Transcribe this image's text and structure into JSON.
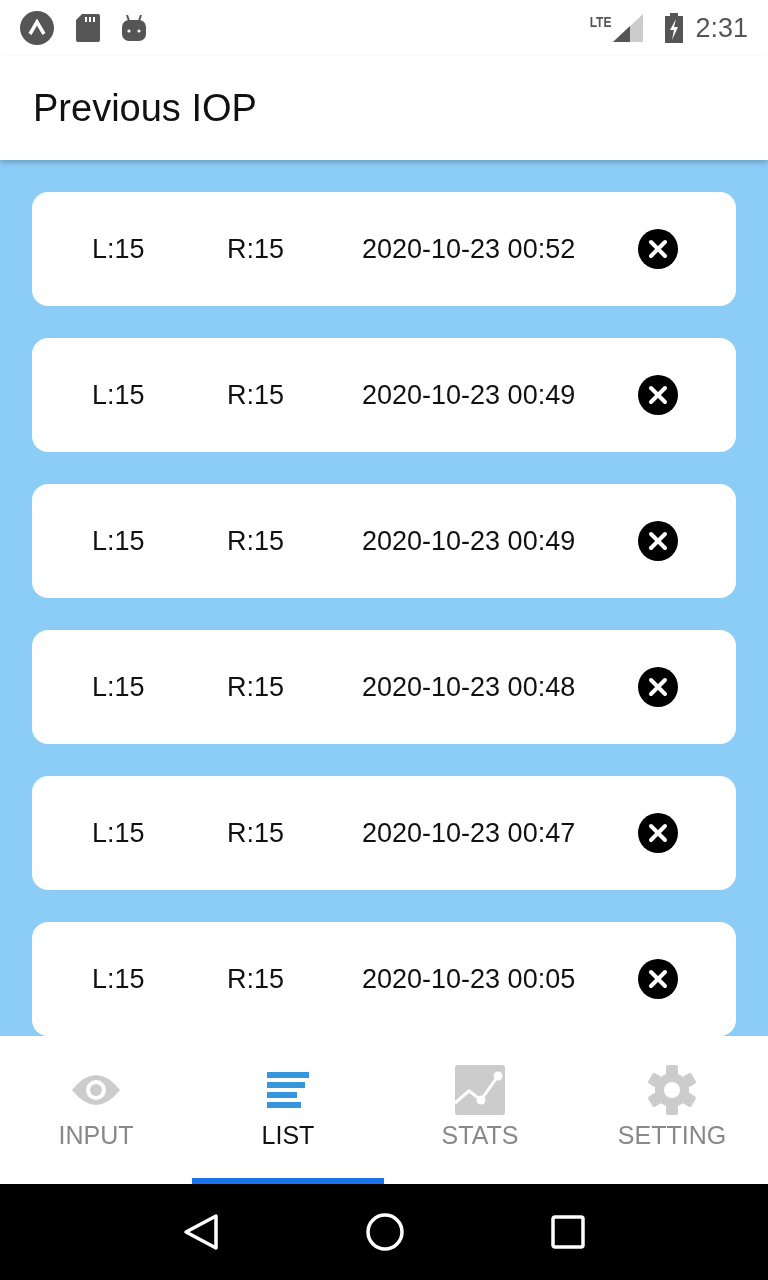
{
  "status_bar": {
    "time": "2:31",
    "network": "LTE"
  },
  "title": "Previous IOP",
  "records": [
    {
      "left": "L:15",
      "right": "R:15",
      "date": "2020-10-23 00:52"
    },
    {
      "left": "L:15",
      "right": "R:15",
      "date": "2020-10-23 00:49"
    },
    {
      "left": "L:15",
      "right": "R:15",
      "date": "2020-10-23 00:49"
    },
    {
      "left": "L:15",
      "right": "R:15",
      "date": "2020-10-23 00:48"
    },
    {
      "left": "L:15",
      "right": "R:15",
      "date": "2020-10-23 00:47"
    },
    {
      "left": "L:15",
      "right": "R:15",
      "date": "2020-10-23 00:05"
    }
  ],
  "tabs": [
    {
      "kind": "eye",
      "label": "INPUT",
      "selected": false
    },
    {
      "kind": "list",
      "label": "LIST",
      "selected": true
    },
    {
      "kind": "chart",
      "label": "STATS",
      "selected": false
    },
    {
      "kind": "gear",
      "label": "SETTING",
      "selected": false
    }
  ]
}
